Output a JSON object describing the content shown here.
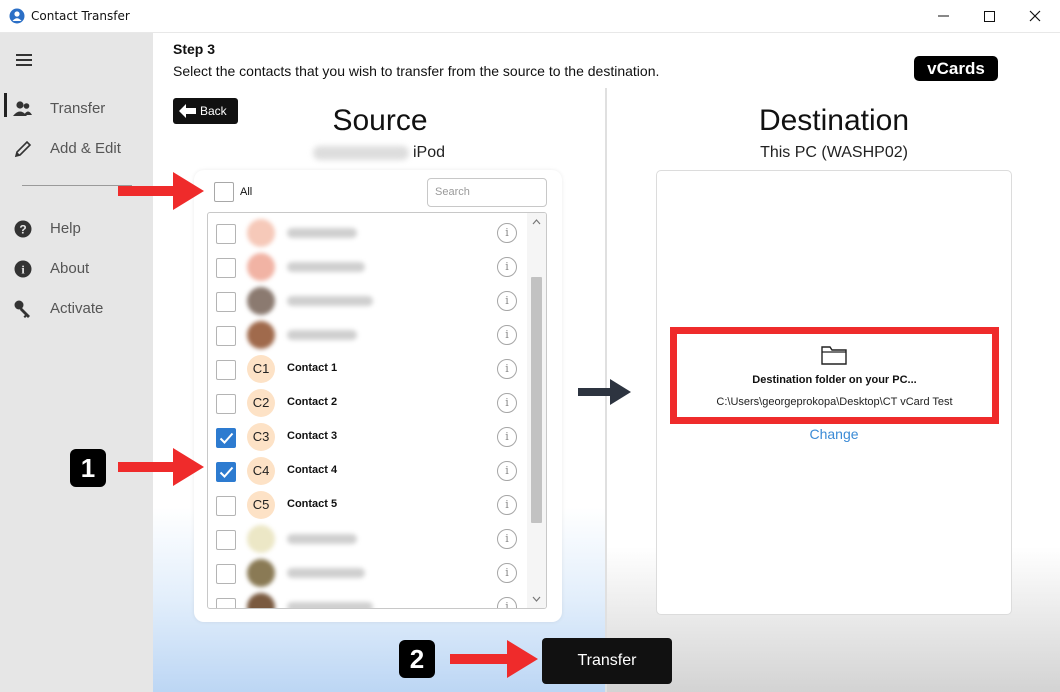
{
  "window": {
    "title": "Contact Transfer"
  },
  "sidebar": {
    "items": [
      {
        "label": "Transfer",
        "icon": "users-icon"
      },
      {
        "label": "Add & Edit",
        "icon": "pencil-icon"
      },
      {
        "label": "Help",
        "icon": "help-icon"
      },
      {
        "label": "About",
        "icon": "info-icon"
      },
      {
        "label": "Activate",
        "icon": "key-icon"
      }
    ]
  },
  "header": {
    "step": "Step 3",
    "description": "Select the contacts that you wish to transfer from the source to the destination.",
    "badge": "vCards"
  },
  "back_button": {
    "label": "Back"
  },
  "source": {
    "title": "Source",
    "device": "iPod",
    "all_label": "All",
    "search_placeholder": "Search",
    "contacts": [
      {
        "initials": "",
        "name": "",
        "checked": false,
        "blurred": true,
        "avatar_color": "#f6c9b9"
      },
      {
        "initials": "",
        "name": "",
        "checked": false,
        "blurred": true,
        "avatar_color": "#f1b3a4"
      },
      {
        "initials": "",
        "name": "",
        "checked": false,
        "blurred": true,
        "avatar_color": "#8b7a70"
      },
      {
        "initials": "",
        "name": "",
        "checked": false,
        "blurred": true,
        "avatar_color": "#a06a4c"
      },
      {
        "initials": "C1",
        "name": "Contact 1",
        "checked": false,
        "blurred": false,
        "avatar_color": "#fde2c6"
      },
      {
        "initials": "C2",
        "name": "Contact 2",
        "checked": false,
        "blurred": false,
        "avatar_color": "#fde2c6"
      },
      {
        "initials": "C3",
        "name": "Contact 3",
        "checked": true,
        "blurred": false,
        "avatar_color": "#fde2c6"
      },
      {
        "initials": "C4",
        "name": "Contact 4",
        "checked": true,
        "blurred": false,
        "avatar_color": "#fde2c6"
      },
      {
        "initials": "C5",
        "name": "Contact 5",
        "checked": false,
        "blurred": false,
        "avatar_color": "#fde2c6"
      },
      {
        "initials": "",
        "name": "",
        "checked": false,
        "blurred": true,
        "avatar_color": "#ece7c6"
      },
      {
        "initials": "",
        "name": "",
        "checked": false,
        "blurred": true,
        "avatar_color": "#8a7a55"
      },
      {
        "initials": "",
        "name": "",
        "checked": false,
        "blurred": true,
        "avatar_color": "#7a5a40"
      }
    ]
  },
  "destination": {
    "title": "Destination",
    "subtitle": "This PC (WASHP02)",
    "folder_title": "Destination folder on your PC...",
    "folder_path": "C:\\Users\\georgeprokopa\\Desktop\\CT vCard Test",
    "change_label": "Change"
  },
  "transfer_button": {
    "label": "Transfer"
  },
  "annotations": {
    "badge_1": "1",
    "badge_2": "2"
  },
  "colors": {
    "accent_blue": "#2d7bd0",
    "annotation_red": "#ef2b2b",
    "link_blue": "#3b8bd6"
  }
}
